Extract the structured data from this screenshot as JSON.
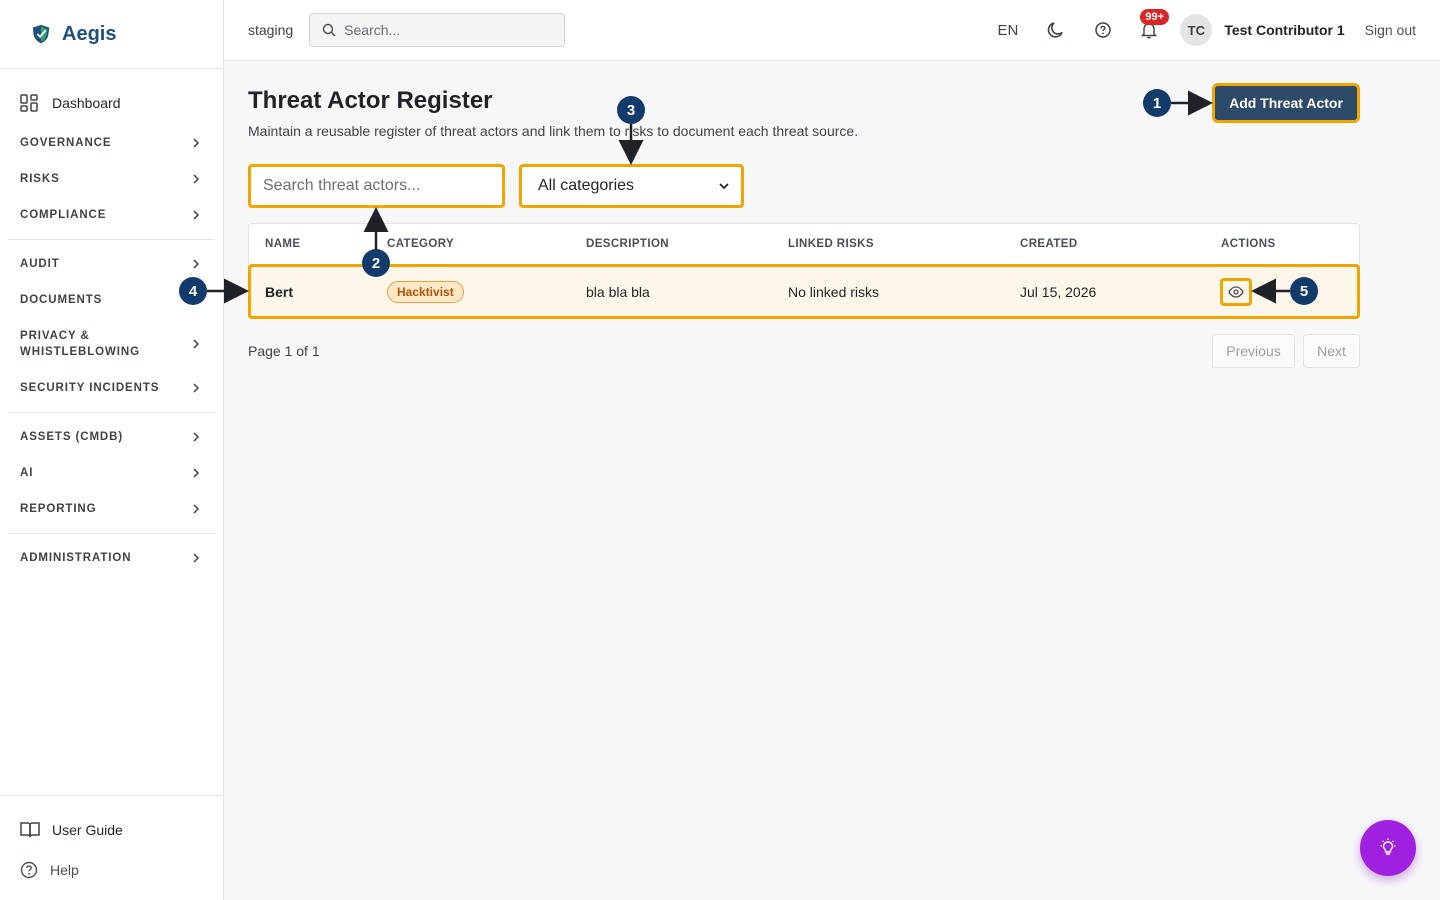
{
  "brand": {
    "name": "Aegis"
  },
  "sidebar": {
    "dashboard": "Dashboard",
    "items": [
      {
        "label": "GOVERNANCE"
      },
      {
        "label": "RISKS"
      },
      {
        "label": "COMPLIANCE"
      },
      {
        "label": "AUDIT"
      },
      {
        "label": "DOCUMENTS"
      },
      {
        "label": "PRIVACY & WHISTLEBLOWING"
      },
      {
        "label": "SECURITY INCIDENTS"
      },
      {
        "label": "ASSETS (CMDB)"
      },
      {
        "label": "AI"
      },
      {
        "label": "REPORTING"
      },
      {
        "label": "ADMINISTRATION"
      }
    ],
    "user_guide": "User Guide",
    "help": "Help"
  },
  "topbar": {
    "environment": "staging",
    "search_placeholder": "Search...",
    "language": "EN",
    "notifications_badge": "99+",
    "avatar_initials": "TC",
    "user_name": "Test Contributor 1",
    "sign_out": "Sign out"
  },
  "page": {
    "title": "Threat Actor Register",
    "subtitle": "Maintain a reusable register of threat actors and link them to risks to document each threat source.",
    "add_button": "Add Threat Actor",
    "filter_search_placeholder": "Search threat actors...",
    "filter_category": "All categories"
  },
  "table": {
    "headers": {
      "name": "NAME",
      "category": "CATEGORY",
      "description": "DESCRIPTION",
      "linked_risks": "LINKED RISKS",
      "created": "CREATED",
      "actions": "ACTIONS"
    },
    "rows": [
      {
        "name": "Bert",
        "category": "Hacktivist",
        "description": "bla bla bla",
        "linked_risks": "No linked risks",
        "created": "Jul 15, 2026"
      }
    ]
  },
  "pagination": {
    "info": "Page 1 of 1",
    "previous": "Previous",
    "next": "Next"
  },
  "annotations": {
    "marker_1": "1",
    "marker_2": "2",
    "marker_3": "3",
    "marker_4": "4",
    "marker_5": "5",
    "marker_color": "#123a6b",
    "highlight_color": "#f0a500"
  },
  "colors": {
    "accent": "#2d4a68",
    "brand": "#1f4f7a",
    "fab": "#a020e0",
    "badge": "#dc2626"
  }
}
